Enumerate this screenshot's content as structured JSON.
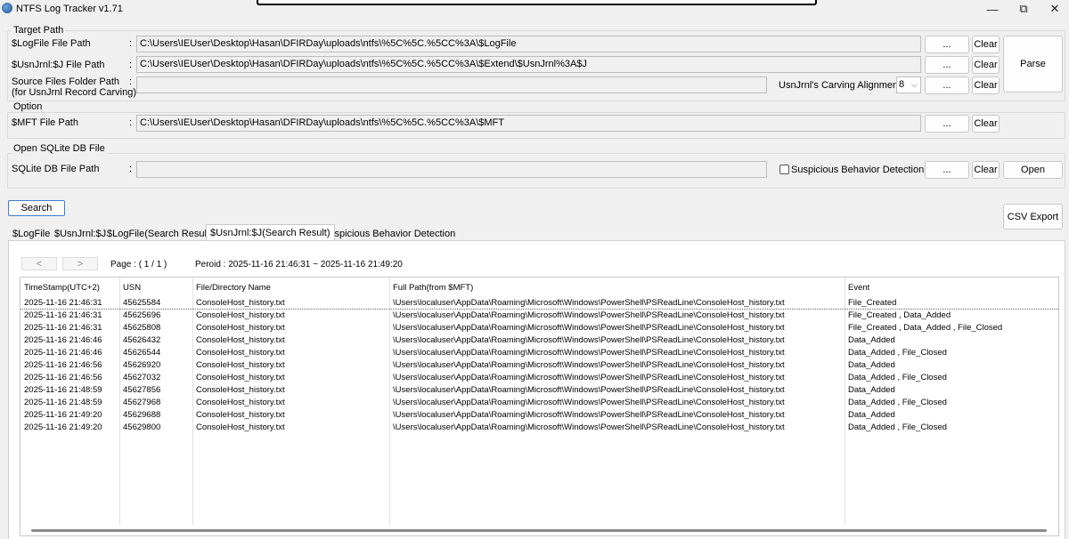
{
  "window": {
    "title": "NTFS Log Tracker v1.71",
    "icons": {
      "app": "app-icon",
      "minimize": "minimize-icon",
      "maximize": "restore-icon",
      "close": "close-icon"
    },
    "min_glyph": "—",
    "max_glyph": "⧉",
    "close_glyph": "✕"
  },
  "target_path": {
    "group_label": "Target Path",
    "logfile_label": "$LogFile File Path",
    "logfile_value": "C:\\Users\\IEUser\\Desktop\\Hasan\\DFIRDay\\uploads\\ntfs\\%5C%5C.%5CC%3A\\$LogFile",
    "usnjrnl_label": "$UsnJrnl:$J File Path",
    "usnjrnl_value": "C:\\Users\\IEUser\\Desktop\\Hasan\\DFIRDay\\uploads\\ntfs\\%5C%5C.%5CC%3A\\$Extend\\$UsnJrnl%3A$J",
    "source_label_line1": "Source Files Folder Path",
    "source_label_line2": "(for UsnJrnl Record Carving)",
    "source_value": "",
    "carving_label": "UsnJrnl's Carving Alignment :",
    "carving_value": "8",
    "colon": ":",
    "browse_label": "...",
    "clear_label": "Clear",
    "parse_label": "Parse"
  },
  "option": {
    "group_label": "Option",
    "mft_label": "$MFT File Path",
    "mft_value": "C:\\Users\\IEUser\\Desktop\\Hasan\\DFIRDay\\uploads\\ntfs\\%5C%5C.%5CC%3A\\$MFT"
  },
  "sqlite": {
    "group_label": "Open SQLite DB File",
    "db_label": "SQLite DB File Path",
    "db_value": "",
    "suspicious_label": "Suspicious Behavior Detection",
    "suspicious_checked": false,
    "open_label": "Open"
  },
  "actions": {
    "search_label": "Search",
    "csv_label": "CSV Export"
  },
  "tabs": [
    {
      "label": "$LogFile"
    },
    {
      "label": "$UsnJrnl:$J"
    },
    {
      "label": "$LogFile(Search Result)"
    },
    {
      "label": "$UsnJrnl:$J(Search Result)",
      "active": true
    },
    {
      "label": "Suspicious Behavior Detection"
    }
  ],
  "pager": {
    "prev_glyph": "<",
    "next_glyph": ">",
    "page_text": "Page : ( 1 / 1 )",
    "period_text": "Peroid :  2025-11-16 21:46:31 ~ 2025-11-16 21:49:20"
  },
  "table": {
    "columns": [
      "TimeStamp(UTC+2)",
      "USN",
      "File/Directory Name",
      "Full Path(from $MFT)",
      "Event"
    ],
    "rows": [
      [
        "2025-11-16 21:46:31",
        "45625584",
        "ConsoleHost_history.txt",
        "\\Users\\localuser\\AppData\\Roaming\\Microsoft\\Windows\\PowerShell\\PSReadLine\\ConsoleHost_history.txt",
        "File_Created"
      ],
      [
        "2025-11-16 21:46:31",
        "45625696",
        "ConsoleHost_history.txt",
        "\\Users\\localuser\\AppData\\Roaming\\Microsoft\\Windows\\PowerShell\\PSReadLine\\ConsoleHost_history.txt",
        "File_Created , Data_Added"
      ],
      [
        "2025-11-16 21:46:31",
        "45625808",
        "ConsoleHost_history.txt",
        "\\Users\\localuser\\AppData\\Roaming\\Microsoft\\Windows\\PowerShell\\PSReadLine\\ConsoleHost_history.txt",
        "File_Created , Data_Added , File_Closed"
      ],
      [
        "2025-11-16 21:46:46",
        "45626432",
        "ConsoleHost_history.txt",
        "\\Users\\localuser\\AppData\\Roaming\\Microsoft\\Windows\\PowerShell\\PSReadLine\\ConsoleHost_history.txt",
        "Data_Added"
      ],
      [
        "2025-11-16 21:46:46",
        "45626544",
        "ConsoleHost_history.txt",
        "\\Users\\localuser\\AppData\\Roaming\\Microsoft\\Windows\\PowerShell\\PSReadLine\\ConsoleHost_history.txt",
        "Data_Added , File_Closed"
      ],
      [
        "2025-11-16 21:46:56",
        "45626920",
        "ConsoleHost_history.txt",
        "\\Users\\localuser\\AppData\\Roaming\\Microsoft\\Windows\\PowerShell\\PSReadLine\\ConsoleHost_history.txt",
        "Data_Added"
      ],
      [
        "2025-11-16 21:46:56",
        "45627032",
        "ConsoleHost_history.txt",
        "\\Users\\localuser\\AppData\\Roaming\\Microsoft\\Windows\\PowerShell\\PSReadLine\\ConsoleHost_history.txt",
        "Data_Added , File_Closed"
      ],
      [
        "2025-11-16 21:48:59",
        "45627856",
        "ConsoleHost_history.txt",
        "\\Users\\localuser\\AppData\\Roaming\\Microsoft\\Windows\\PowerShell\\PSReadLine\\ConsoleHost_history.txt",
        "Data_Added"
      ],
      [
        "2025-11-16 21:48:59",
        "45627968",
        "ConsoleHost_history.txt",
        "\\Users\\localuser\\AppData\\Roaming\\Microsoft\\Windows\\PowerShell\\PSReadLine\\ConsoleHost_history.txt",
        "Data_Added , File_Closed"
      ],
      [
        "2025-11-16 21:49:20",
        "45629688",
        "ConsoleHost_history.txt",
        "\\Users\\localuser\\AppData\\Roaming\\Microsoft\\Windows\\PowerShell\\PSReadLine\\ConsoleHost_history.txt",
        "Data_Added"
      ],
      [
        "2025-11-16 21:49:20",
        "45629800",
        "ConsoleHost_history.txt",
        "\\Users\\localuser\\AppData\\Roaming\\Microsoft\\Windows\\PowerShell\\PSReadLine\\ConsoleHost_history.txt",
        "Data_Added , File_Closed"
      ]
    ]
  }
}
